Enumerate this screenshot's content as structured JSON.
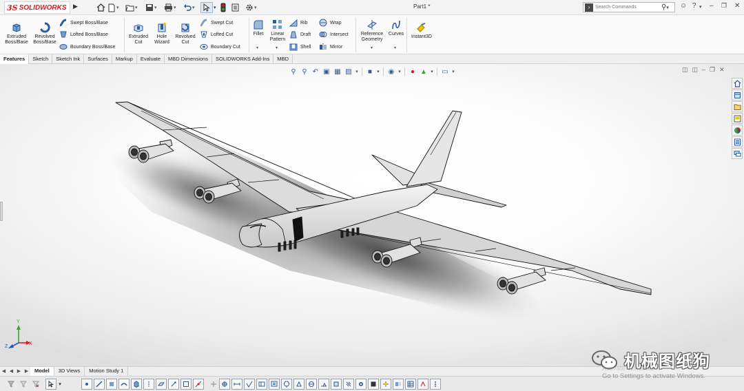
{
  "app": {
    "brand_prefix": "3S",
    "brand": "SOLIDWORKS",
    "document_title": "Part1 *",
    "search_placeholder": "Search Commands"
  },
  "colors": {
    "brand_red": "#d71920",
    "icon_blue": "#3a6ea5",
    "accent_yellow": "#f2c200"
  },
  "ribbon": {
    "features": {
      "extruded_boss": "Extruded Boss/Base",
      "revolved_boss": "Revolved Boss/Base",
      "swept_boss": "Swept Boss/Base",
      "lofted_boss": "Lofted Boss/Base",
      "boundary_boss": "Boundary Boss/Base",
      "extruded_cut": "Extruded Cut",
      "hole_wizard": "Hole Wizard",
      "revolved_cut": "Revolved Cut",
      "swept_cut": "Swept Cut",
      "lofted_cut": "Lofted Cut",
      "boundary_cut": "Boundary Cut",
      "fillet": "Fillet",
      "linear_pattern": "Linear Pattern",
      "rib": "Rib",
      "draft": "Draft",
      "shell": "Shell",
      "wrap": "Wrap",
      "intersect": "Intersect",
      "mirror": "Mirror",
      "reference_geometry": "Reference Geometry",
      "curves": "Curves",
      "instant3d": "Instant3D"
    }
  },
  "command_tabs": [
    "Features",
    "Sketch",
    "Sketch Ink",
    "Surfaces",
    "Markup",
    "Evaluate",
    "MBD Dimensions",
    "SOLIDWORKS Add-Ins",
    "MBD"
  ],
  "bottom_tabs": [
    "Model",
    "3D Views",
    "Motion Study 1"
  ],
  "triad": {
    "x": "X",
    "y": "Y",
    "z": "Z"
  },
  "windows_notice": {
    "title": "Activate Windows",
    "message": "Go to Settings to activate Windows."
  },
  "watermark": {
    "text": "机械图纸狗",
    "icon": "wechat-icon"
  }
}
